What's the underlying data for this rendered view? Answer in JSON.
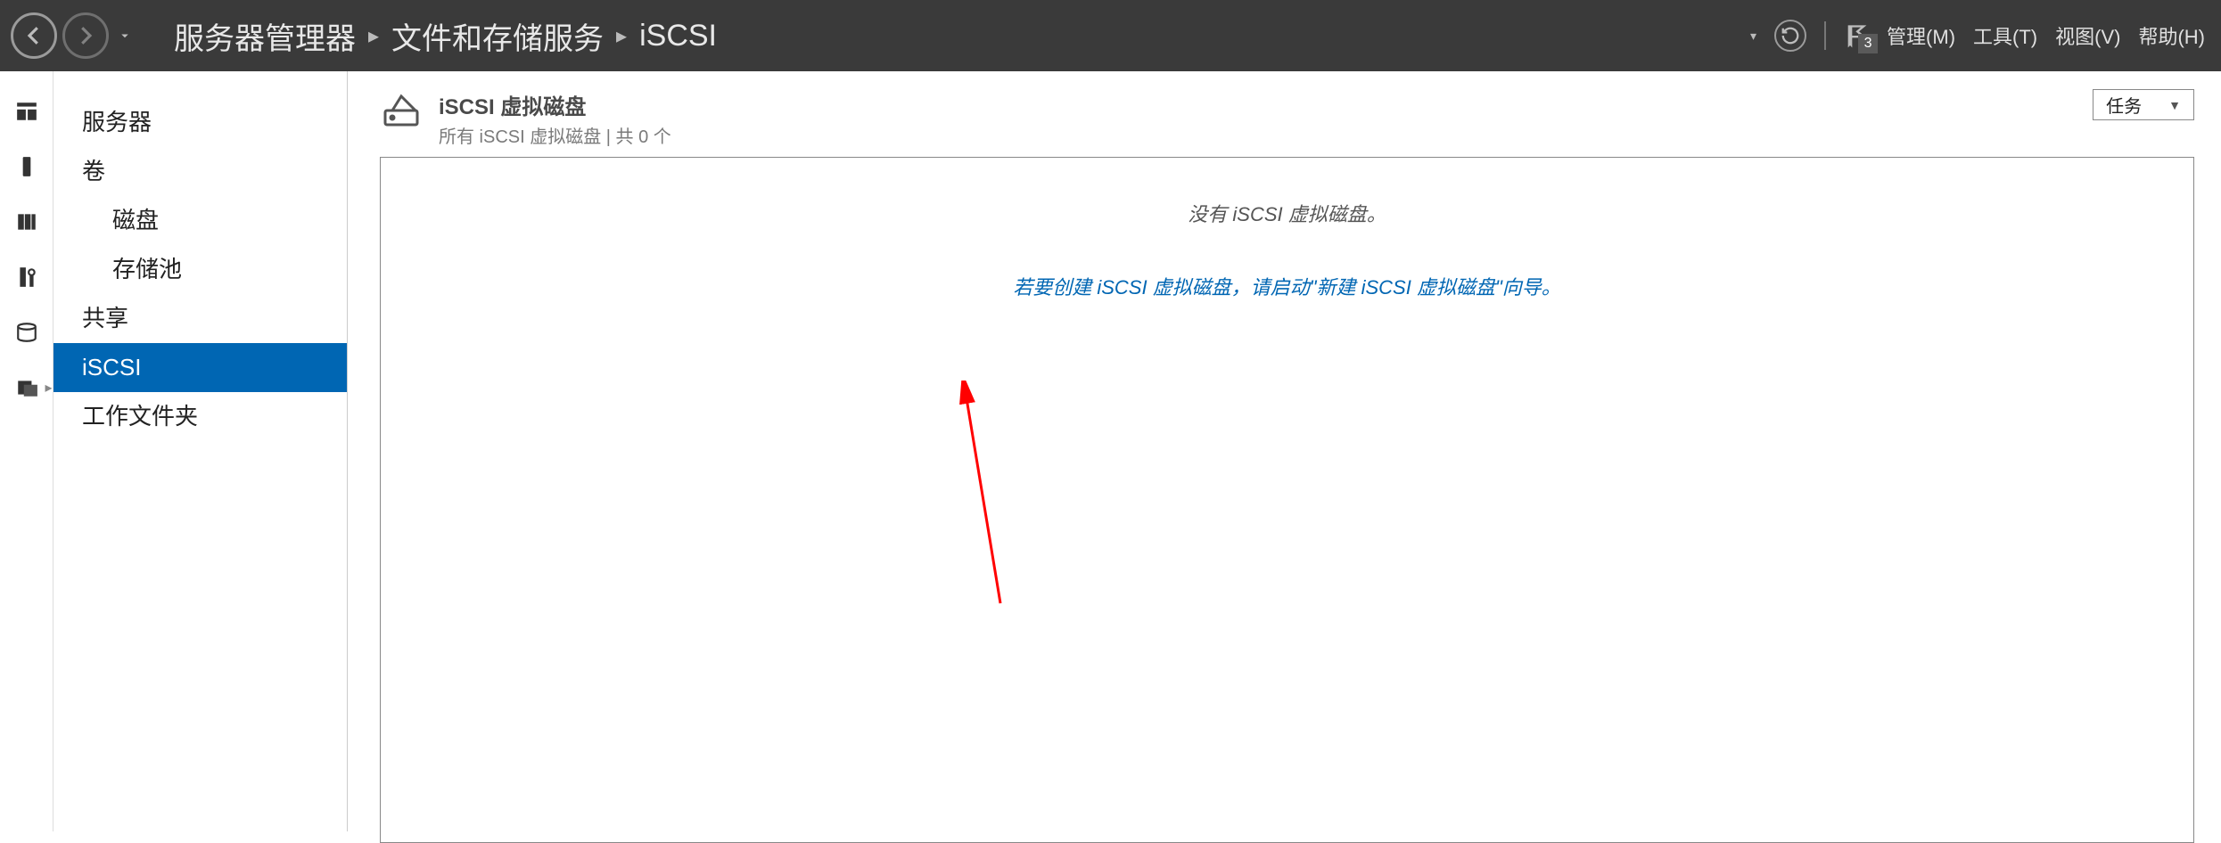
{
  "titlebar": {
    "breadcrumb": [
      "服务器管理器",
      "文件和存储服务",
      "iSCSI"
    ],
    "notifications_count": "3",
    "menu": {
      "manage": "管理(M)",
      "tools": "工具(T)",
      "view": "视图(V)",
      "help": "帮助(H)"
    }
  },
  "iconrail": {
    "items": [
      "dashboard",
      "local-server",
      "all-servers",
      "tools",
      "drives",
      "file-storage"
    ]
  },
  "sidebar": {
    "items": [
      {
        "label": "服务器",
        "indent": 0
      },
      {
        "label": "卷",
        "indent": 0
      },
      {
        "label": "磁盘",
        "indent": 1
      },
      {
        "label": "存储池",
        "indent": 1
      },
      {
        "label": "共享",
        "indent": 0
      },
      {
        "label": "iSCSI",
        "indent": 0,
        "selected": true
      },
      {
        "label": "工作文件夹",
        "indent": 0
      }
    ]
  },
  "main": {
    "panel_title": "iSCSI 虚拟磁盘",
    "panel_subtitle": "所有 iSCSI 虚拟磁盘 | 共 0 个",
    "tasks_label": "任务",
    "empty_text": "没有 iSCSI 虚拟磁盘。",
    "wizard_link": "若要创建 iSCSI 虚拟磁盘，请启动\"新建 iSCSI 虚拟磁盘\"向导。"
  }
}
